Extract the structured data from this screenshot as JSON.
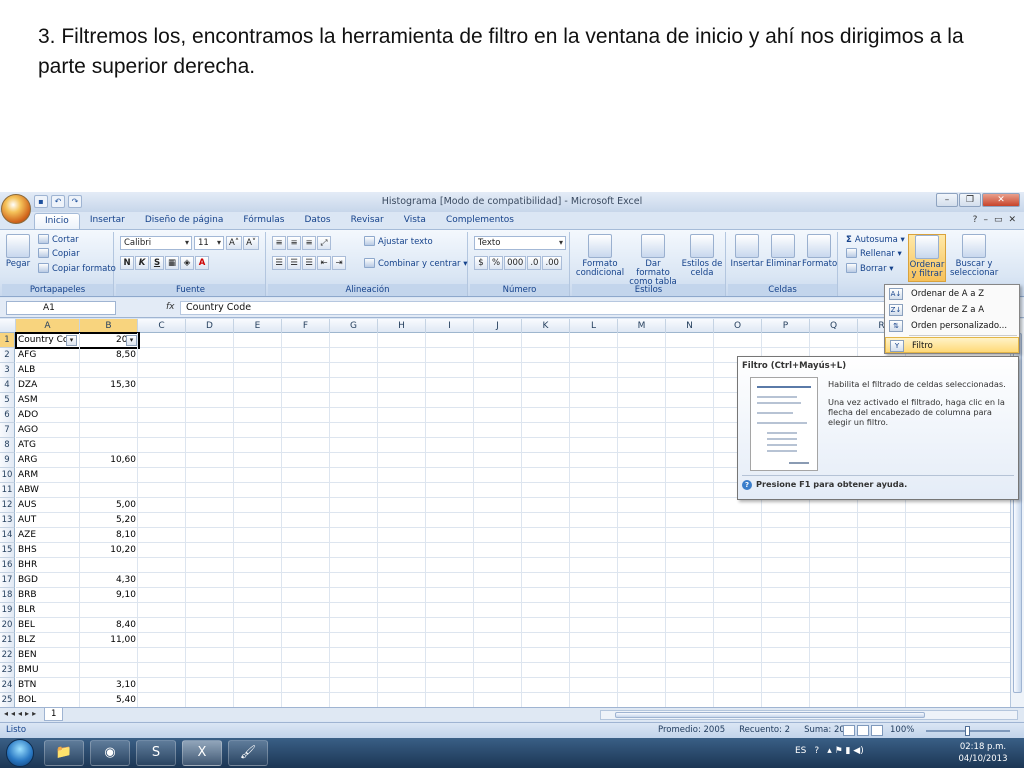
{
  "slide": {
    "instruction": "3. Filtremos los, encontramos la herramienta de filtro en la ventana de inicio y ahí nos dirigimos a la parte superior derecha."
  },
  "window": {
    "title": "Histograma [Modo de compatibilidad] - Microsoft Excel"
  },
  "tabs": [
    "Inicio",
    "Insertar",
    "Diseño de página",
    "Fórmulas",
    "Datos",
    "Revisar",
    "Vista",
    "Complementos"
  ],
  "ribbon": {
    "clipboard": {
      "label": "Portapapeles",
      "paste": "Pegar",
      "cut": "Cortar",
      "copy": "Copiar",
      "format_painter": "Copiar formato"
    },
    "font": {
      "label": "Fuente",
      "font_name": "Calibri",
      "font_size": "11",
      "bold": "N",
      "italic": "K",
      "underline": "S"
    },
    "alignment": {
      "label": "Alineación",
      "wrap_text": "Ajustar texto",
      "merge_center": "Combinar y centrar"
    },
    "number": {
      "label": "Número",
      "format": "Texto",
      "currency": "$",
      "percent": "%",
      "thousands": "000"
    },
    "styles": {
      "label": "Estilos",
      "conditional": "Formato condicional",
      "as_table": "Dar formato como tabla",
      "cell_styles": "Estilos de celda"
    },
    "cells": {
      "label": "Celdas",
      "insert": "Insertar",
      "delete": "Eliminar",
      "format": "Formato"
    },
    "editing": {
      "autosum": "Autosuma",
      "fill": "Rellenar",
      "clear": "Borrar",
      "sort_filter": "Ordenar y filtrar",
      "find_select": "Buscar y seleccionar"
    }
  },
  "formula_bar": {
    "name_box": "A1",
    "fx": "fx",
    "content": "Country Code"
  },
  "columns": [
    "A",
    "B",
    "C",
    "D",
    "E",
    "F",
    "G",
    "H",
    "I",
    "J",
    "K",
    "L",
    "M",
    "N",
    "O",
    "P",
    "Q",
    "R"
  ],
  "header_row": {
    "a": "Country Cc",
    "b": "20"
  },
  "rows": [
    {
      "n": "2",
      "a": "AFG",
      "b": "8,50"
    },
    {
      "n": "3",
      "a": "ALB",
      "b": ""
    },
    {
      "n": "4",
      "a": "DZA",
      "b": "15,30"
    },
    {
      "n": "5",
      "a": "ASM",
      "b": ""
    },
    {
      "n": "6",
      "a": "ADO",
      "b": ""
    },
    {
      "n": "7",
      "a": "AGO",
      "b": ""
    },
    {
      "n": "8",
      "a": "ATG",
      "b": ""
    },
    {
      "n": "9",
      "a": "ARG",
      "b": "10,60"
    },
    {
      "n": "10",
      "a": "ARM",
      "b": ""
    },
    {
      "n": "11",
      "a": "ABW",
      "b": ""
    },
    {
      "n": "12",
      "a": "AUS",
      "b": "5,00"
    },
    {
      "n": "13",
      "a": "AUT",
      "b": "5,20"
    },
    {
      "n": "14",
      "a": "AZE",
      "b": "8,10"
    },
    {
      "n": "15",
      "a": "BHS",
      "b": "10,20"
    },
    {
      "n": "16",
      "a": "BHR",
      "b": ""
    },
    {
      "n": "17",
      "a": "BGD",
      "b": "4,30"
    },
    {
      "n": "18",
      "a": "BRB",
      "b": "9,10"
    },
    {
      "n": "19",
      "a": "BLR",
      "b": ""
    },
    {
      "n": "20",
      "a": "BEL",
      "b": "8,40"
    },
    {
      "n": "21",
      "a": "BLZ",
      "b": "11,00"
    },
    {
      "n": "22",
      "a": "BEN",
      "b": ""
    },
    {
      "n": "23",
      "a": "BMU",
      "b": ""
    },
    {
      "n": "24",
      "a": "BTN",
      "b": "3,10"
    },
    {
      "n": "25",
      "a": "BOL",
      "b": "5,40"
    }
  ],
  "sheet_tab": "1",
  "status": {
    "mode": "Listo",
    "average": "Promedio: 2005",
    "count": "Recuento: 2",
    "sum": "Suma: 2005",
    "zoom": "100%"
  },
  "menu": {
    "sort_az": "Ordenar de A a Z",
    "sort_za": "Ordenar de Z a A",
    "custom_sort": "Orden personalizado...",
    "filter": "Filtro"
  },
  "tooltip": {
    "title": "Filtro (Ctrl+Mayús+L)",
    "desc1": "Habilita el filtrado de celdas seleccionadas.",
    "desc2": "Una vez activado el filtrado, haga clic en la flecha del encabezado de columna para elegir un filtro.",
    "help": "Presione F1 para obtener ayuda."
  },
  "taskbar": {
    "language": "ES",
    "time": "02:18 p.m.",
    "date": "04/10/2013"
  }
}
